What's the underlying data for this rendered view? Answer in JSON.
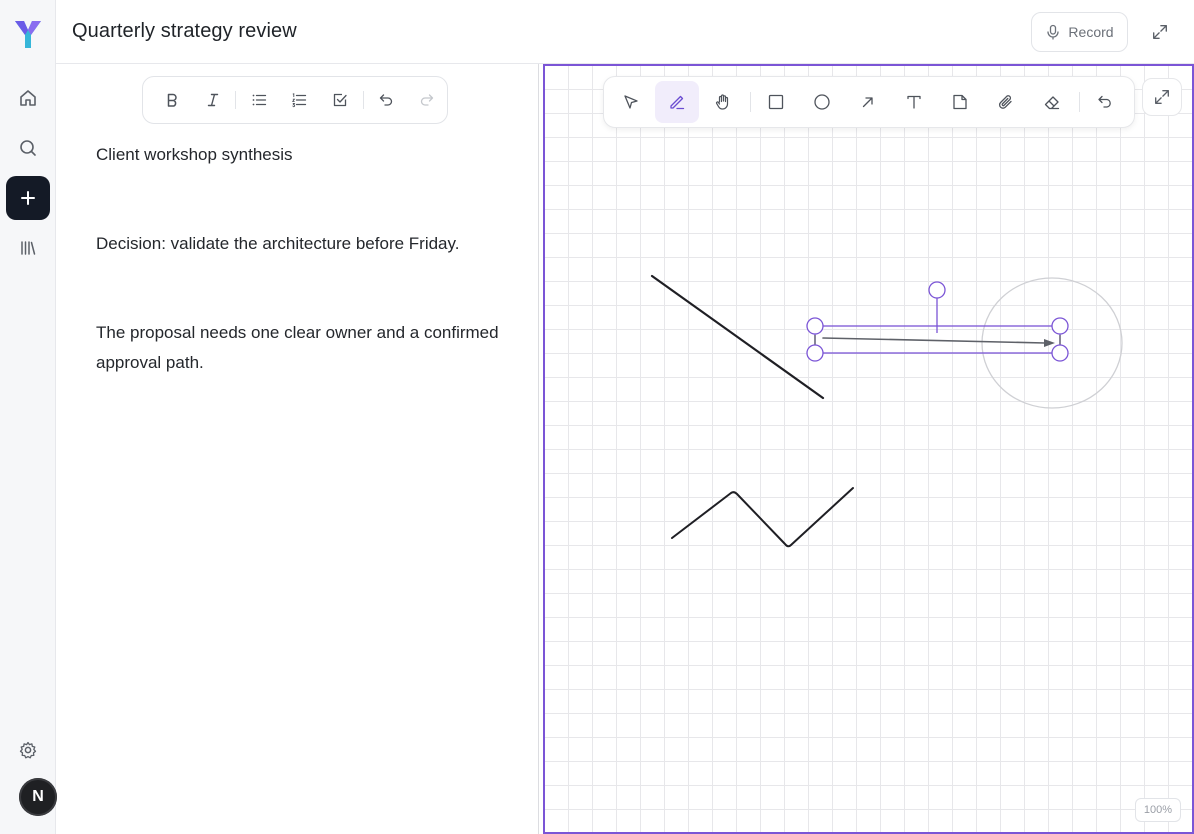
{
  "document": {
    "title": "Quarterly strategy review"
  },
  "header": {
    "record_label": "Record"
  },
  "rail": {
    "avatar_initial": "N"
  },
  "editor": {
    "paragraphs": [
      "Client workshop synthesis",
      "Decision: validate the architecture before Friday.",
      "The proposal needs one clear owner and a confirmed approval path."
    ]
  },
  "canvas": {
    "zoom_label": "100%",
    "active_tool": "pen",
    "colors": {
      "accent": "#7b55d6",
      "stroke": "#1f1f24",
      "arrow": "#5e6168"
    }
  }
}
